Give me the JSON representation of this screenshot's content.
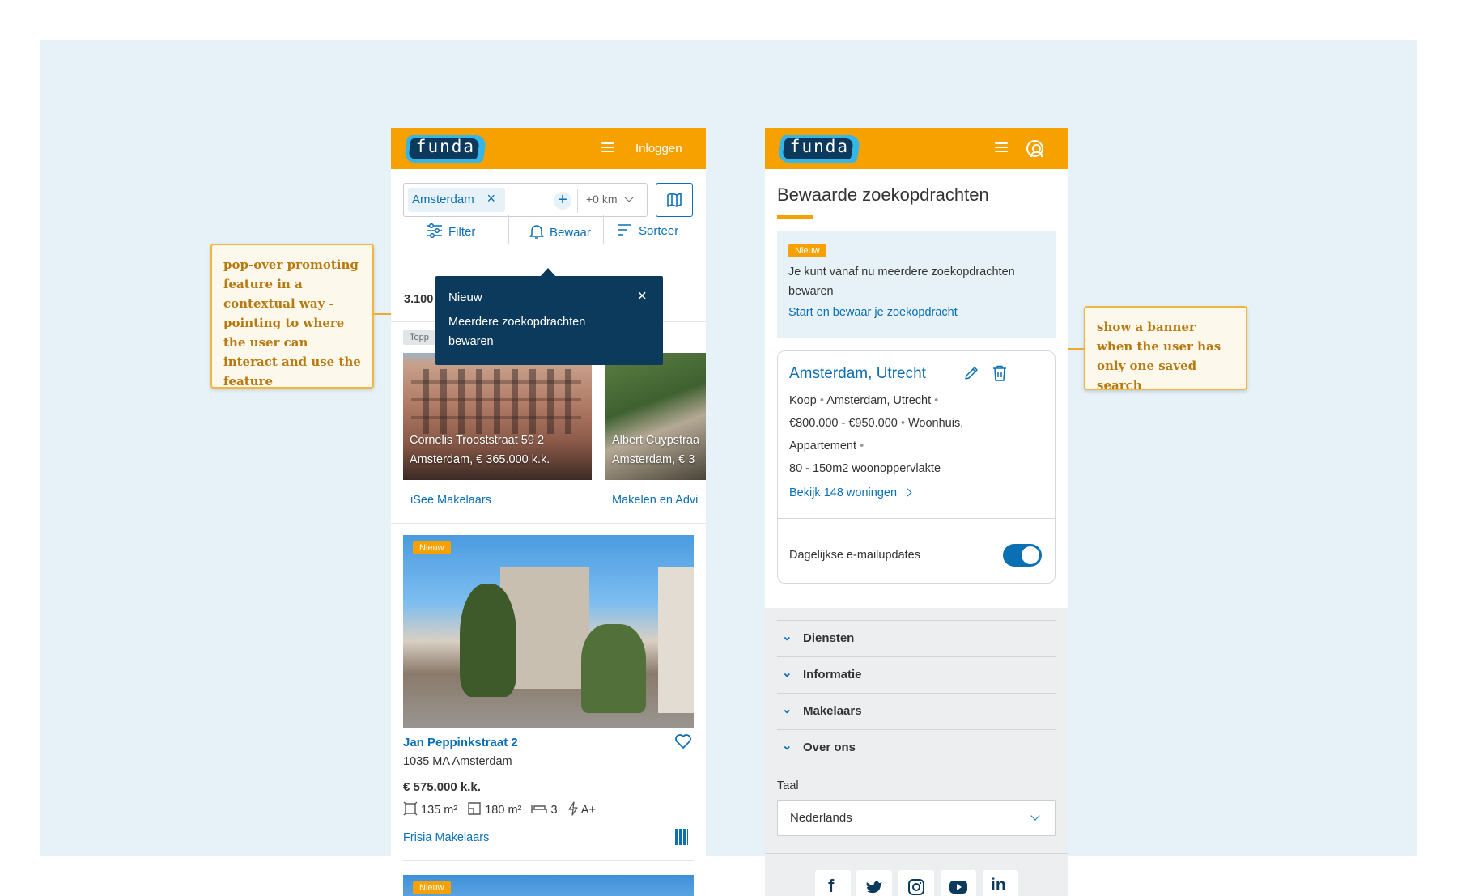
{
  "left_phone": {
    "logo": "funda",
    "login": "Inloggen",
    "search": {
      "chip": "Amsterdam",
      "chip_remove": "×",
      "add": "+",
      "radius": "+0 km"
    },
    "toolbar": {
      "filter": "Filter",
      "save": "Bewaar",
      "sort": "Sorteer"
    },
    "results_count": "3.100",
    "top_label": "Topp",
    "popover": {
      "title": "Nieuw",
      "text": "Meerdere zoekopdrachten bewaren",
      "close": "×"
    },
    "carousel": [
      {
        "line1": "Cornelis Trooststraat 59 2",
        "line2": "Amsterdam, € 365.000 k.k.",
        "agent": "iSee Makelaars"
      },
      {
        "line1": "Albert Cuypstraa",
        "line2": "Amsterdam, € 3",
        "agent": "Makelen en Advi"
      }
    ],
    "listing": {
      "badge": "Nieuw",
      "title": "Jan Peppinkstraat 2",
      "postcode": "1035 MA Amsterdam",
      "price": "€ 575.000 k.k.",
      "living_area": "135 m²",
      "plot_area": "180 m²",
      "rooms": "3",
      "energy": "A+",
      "agent": "Frisia Makelaars"
    },
    "next_badge": "Nieuw"
  },
  "right_phone": {
    "logo": "funda",
    "page_title": "Bewaarde zoekopdrachten",
    "banner": {
      "badge": "Nieuw",
      "text": "Je kunt vanaf nu meerdere zoekopdrachten bewaren",
      "link": "Start en bewaar je zoekopdracht"
    },
    "saved_search": {
      "title": "Amsterdam, Utrecht",
      "line1_a": "Koop",
      "line1_b": "Amsterdam, Utrecht",
      "line2_a": "€800.000 - €950.000",
      "line2_b": "Woonhuis,",
      "line3": "Appartement",
      "line4": "80 - 150m2 woonoppervlakte",
      "link": "Bekijk 148 woningen",
      "email_updates": "Dagelijkse e-mailupdates",
      "email_updates_on": true
    },
    "footer": {
      "sections": [
        "Diensten",
        "Informatie",
        "Makelaars",
        "Over ons"
      ],
      "language_label": "Taal",
      "language_value": "Nederlands",
      "social": [
        "facebook-icon",
        "twitter-icon",
        "instagram-icon",
        "youtube-icon",
        "linkedin-icon"
      ]
    }
  },
  "annotations": {
    "left": "pop-over promoting feature in a contextual way - pointing to where the user can interact and use the feature",
    "right": "show a banner when the user has only one saved search"
  },
  "colors": {
    "brand_orange": "#f7a100",
    "link_blue": "#0b6fb3",
    "navy": "#0c3a5c",
    "canvas": "#e6f1f8",
    "annotation": "#f2b63c"
  }
}
